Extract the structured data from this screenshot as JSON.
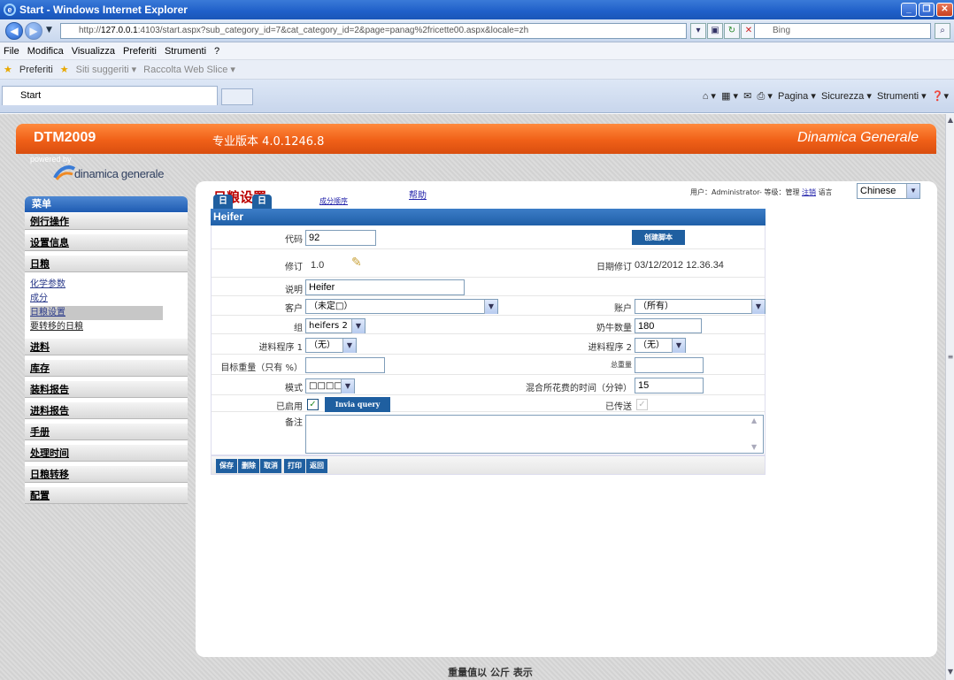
{
  "window": {
    "title": "Start - Windows Internet Explorer"
  },
  "browser": {
    "url_prefix": "http://",
    "url_host": "127.0.0.1",
    "url_rest": ":4103/start.aspx?sub_category_id=7&cat_category_id=2&page=panag%2fricette00.aspx&locale=zh",
    "search_placeholder": "Bing",
    "menu": [
      "File",
      "Modifica",
      "Visualizza",
      "Preferiti",
      "Strumenti",
      "?"
    ],
    "favorites": {
      "label": "Preferiti",
      "suggested": "Siti suggeriti ▾",
      "slice": "Raccolta Web Slice ▾"
    },
    "tab_title": "Start",
    "tools": {
      "page": "Pagina ▾",
      "security": "Sicurezza ▾",
      "tools": "Strumenti ▾"
    }
  },
  "app": {
    "brand": "DTM2009",
    "version": "专业版本 4.0.1246.8",
    "company": "Dinamica Generale",
    "logo_powered": "powered by",
    "logo_name": "dinamica generale"
  },
  "header": {
    "title": "日粮设置",
    "help": "帮助",
    "user_prefix": "用户：",
    "user_name": "Administrator",
    "level": "- 等级：",
    "role": "管理",
    "logout": "注销",
    "lang_label": "语言",
    "language": "Chinese"
  },
  "sidebar": {
    "header": "菜单",
    "groups_top": [
      "例行操作",
      "设置信息",
      "日粮"
    ],
    "sub_items": [
      "化学参数",
      "成分",
      "日粮设置",
      "要转移的日粮"
    ],
    "groups_bottom": [
      "进料",
      "库存",
      "装料报告",
      "进料报告",
      "手册",
      "处理时间",
      "日粮转移",
      "配置"
    ]
  },
  "tabs": [
    "日粮",
    "日粮成分",
    "成分顺序"
  ],
  "form": {
    "header": "Heifer",
    "code_label": "代码",
    "code": "92",
    "create_script": "创建脚本",
    "revision_label": "修订",
    "revision": "1.0",
    "date_label": "日期修订",
    "date": "03/12/2012 12.36.34",
    "desc_label": "说明",
    "desc": "Heifer",
    "customer_label": "客户",
    "customer": "（未定□）",
    "account_label": "账户",
    "account": "（所有）",
    "group_label": "组",
    "group": "heifers 2",
    "cows_label": "奶牛数量",
    "cows": "180",
    "prog1_label": "进料程序 1",
    "prog1": "（无）",
    "prog2_label": "进料程序 2",
    "prog2": "（无）",
    "target_label": "目标重量（只有 %）",
    "target": "",
    "total_label": "总重量",
    "total": "",
    "mode_label": "模式",
    "mode": "□□□□□",
    "mix_label": "混合所花费的时间（分钟）",
    "mix": "15",
    "enabled_label": "已启用",
    "enabled": true,
    "send_query": "Invia query",
    "sent_label": "已传送",
    "sent": true,
    "notes_label": "备注",
    "notes": ""
  },
  "actions": [
    "保存",
    "删除",
    "取消",
    "打印",
    "返回"
  ],
  "footer": "重量值以 公斤 表示"
}
